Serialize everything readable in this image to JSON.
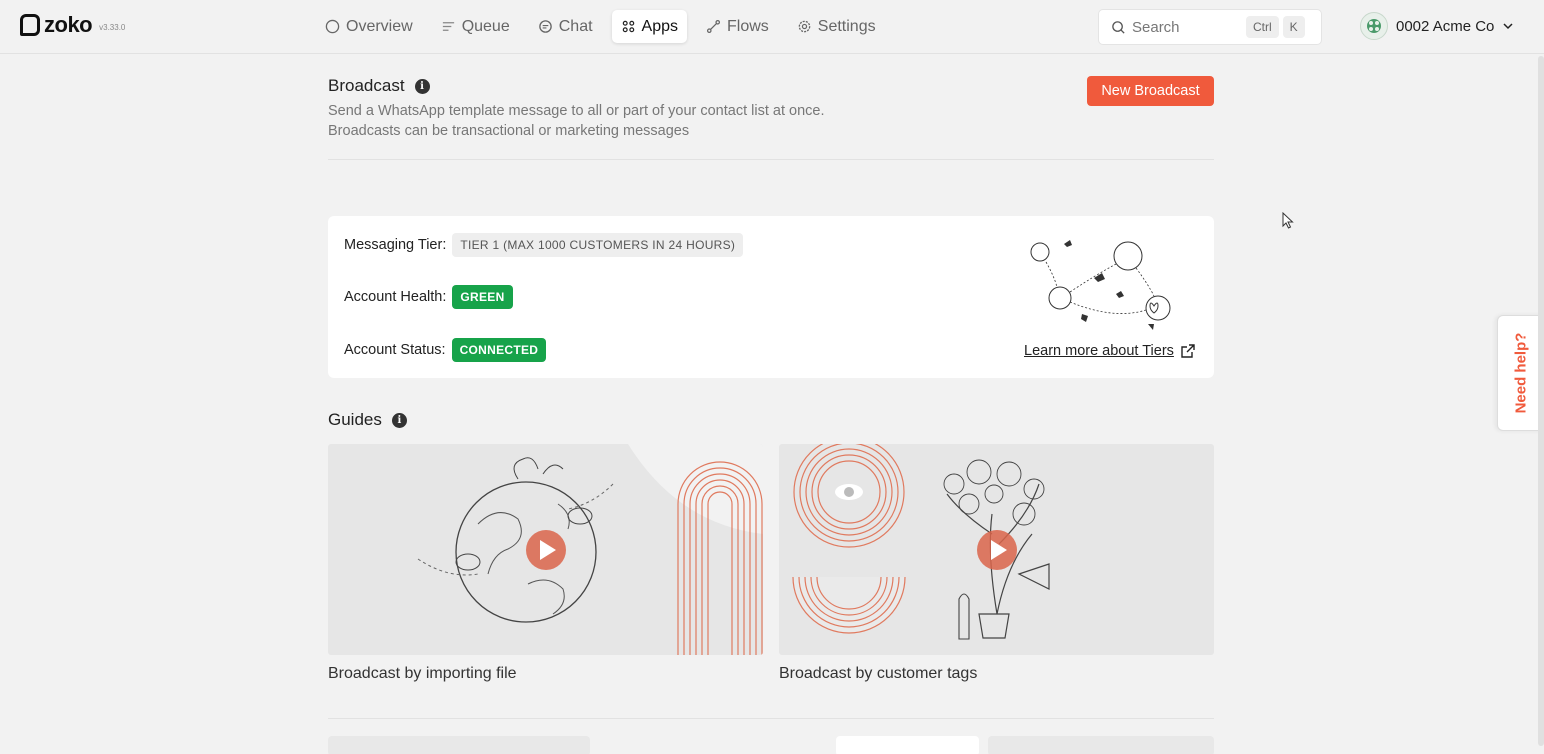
{
  "app": {
    "brand": "zoko",
    "version": "v3.33.0"
  },
  "nav": {
    "items": [
      {
        "label": "Overview",
        "icon": "circle-icon"
      },
      {
        "label": "Queue",
        "icon": "list-icon"
      },
      {
        "label": "Chat",
        "icon": "chat-icon"
      },
      {
        "label": "Apps",
        "icon": "grid-icon",
        "active": true
      },
      {
        "label": "Flows",
        "icon": "flow-icon"
      },
      {
        "label": "Settings",
        "icon": "gear-icon"
      }
    ]
  },
  "search": {
    "placeholder": "Search",
    "shortcut_mod": "Ctrl",
    "shortcut_key": "K"
  },
  "account": {
    "name": "0002 Acme Co"
  },
  "page": {
    "title": "Broadcast",
    "description_line1": "Send a WhatsApp template message to all or part of your contact list at once.",
    "description_line2": "Broadcasts can be transactional or marketing messages",
    "new_button": "New Broadcast"
  },
  "tier_card": {
    "messaging_tier_label": "Messaging Tier:",
    "messaging_tier_value": "TIER 1 (MAX 1000 CUSTOMERS IN 24 HOURS)",
    "account_health_label": "Account Health:",
    "account_health_value": "GREEN",
    "account_status_label": "Account Status:",
    "account_status_value": "CONNECTED",
    "learn_more": "Learn more about Tiers"
  },
  "guides": {
    "title": "Guides",
    "items": [
      {
        "label": "Broadcast by importing file"
      },
      {
        "label": "Broadcast by customer tags"
      }
    ]
  },
  "help": {
    "label": "Need help?"
  },
  "colors": {
    "accent": "#f05a3c",
    "success": "#17a34a",
    "background": "#f2f2f2"
  }
}
